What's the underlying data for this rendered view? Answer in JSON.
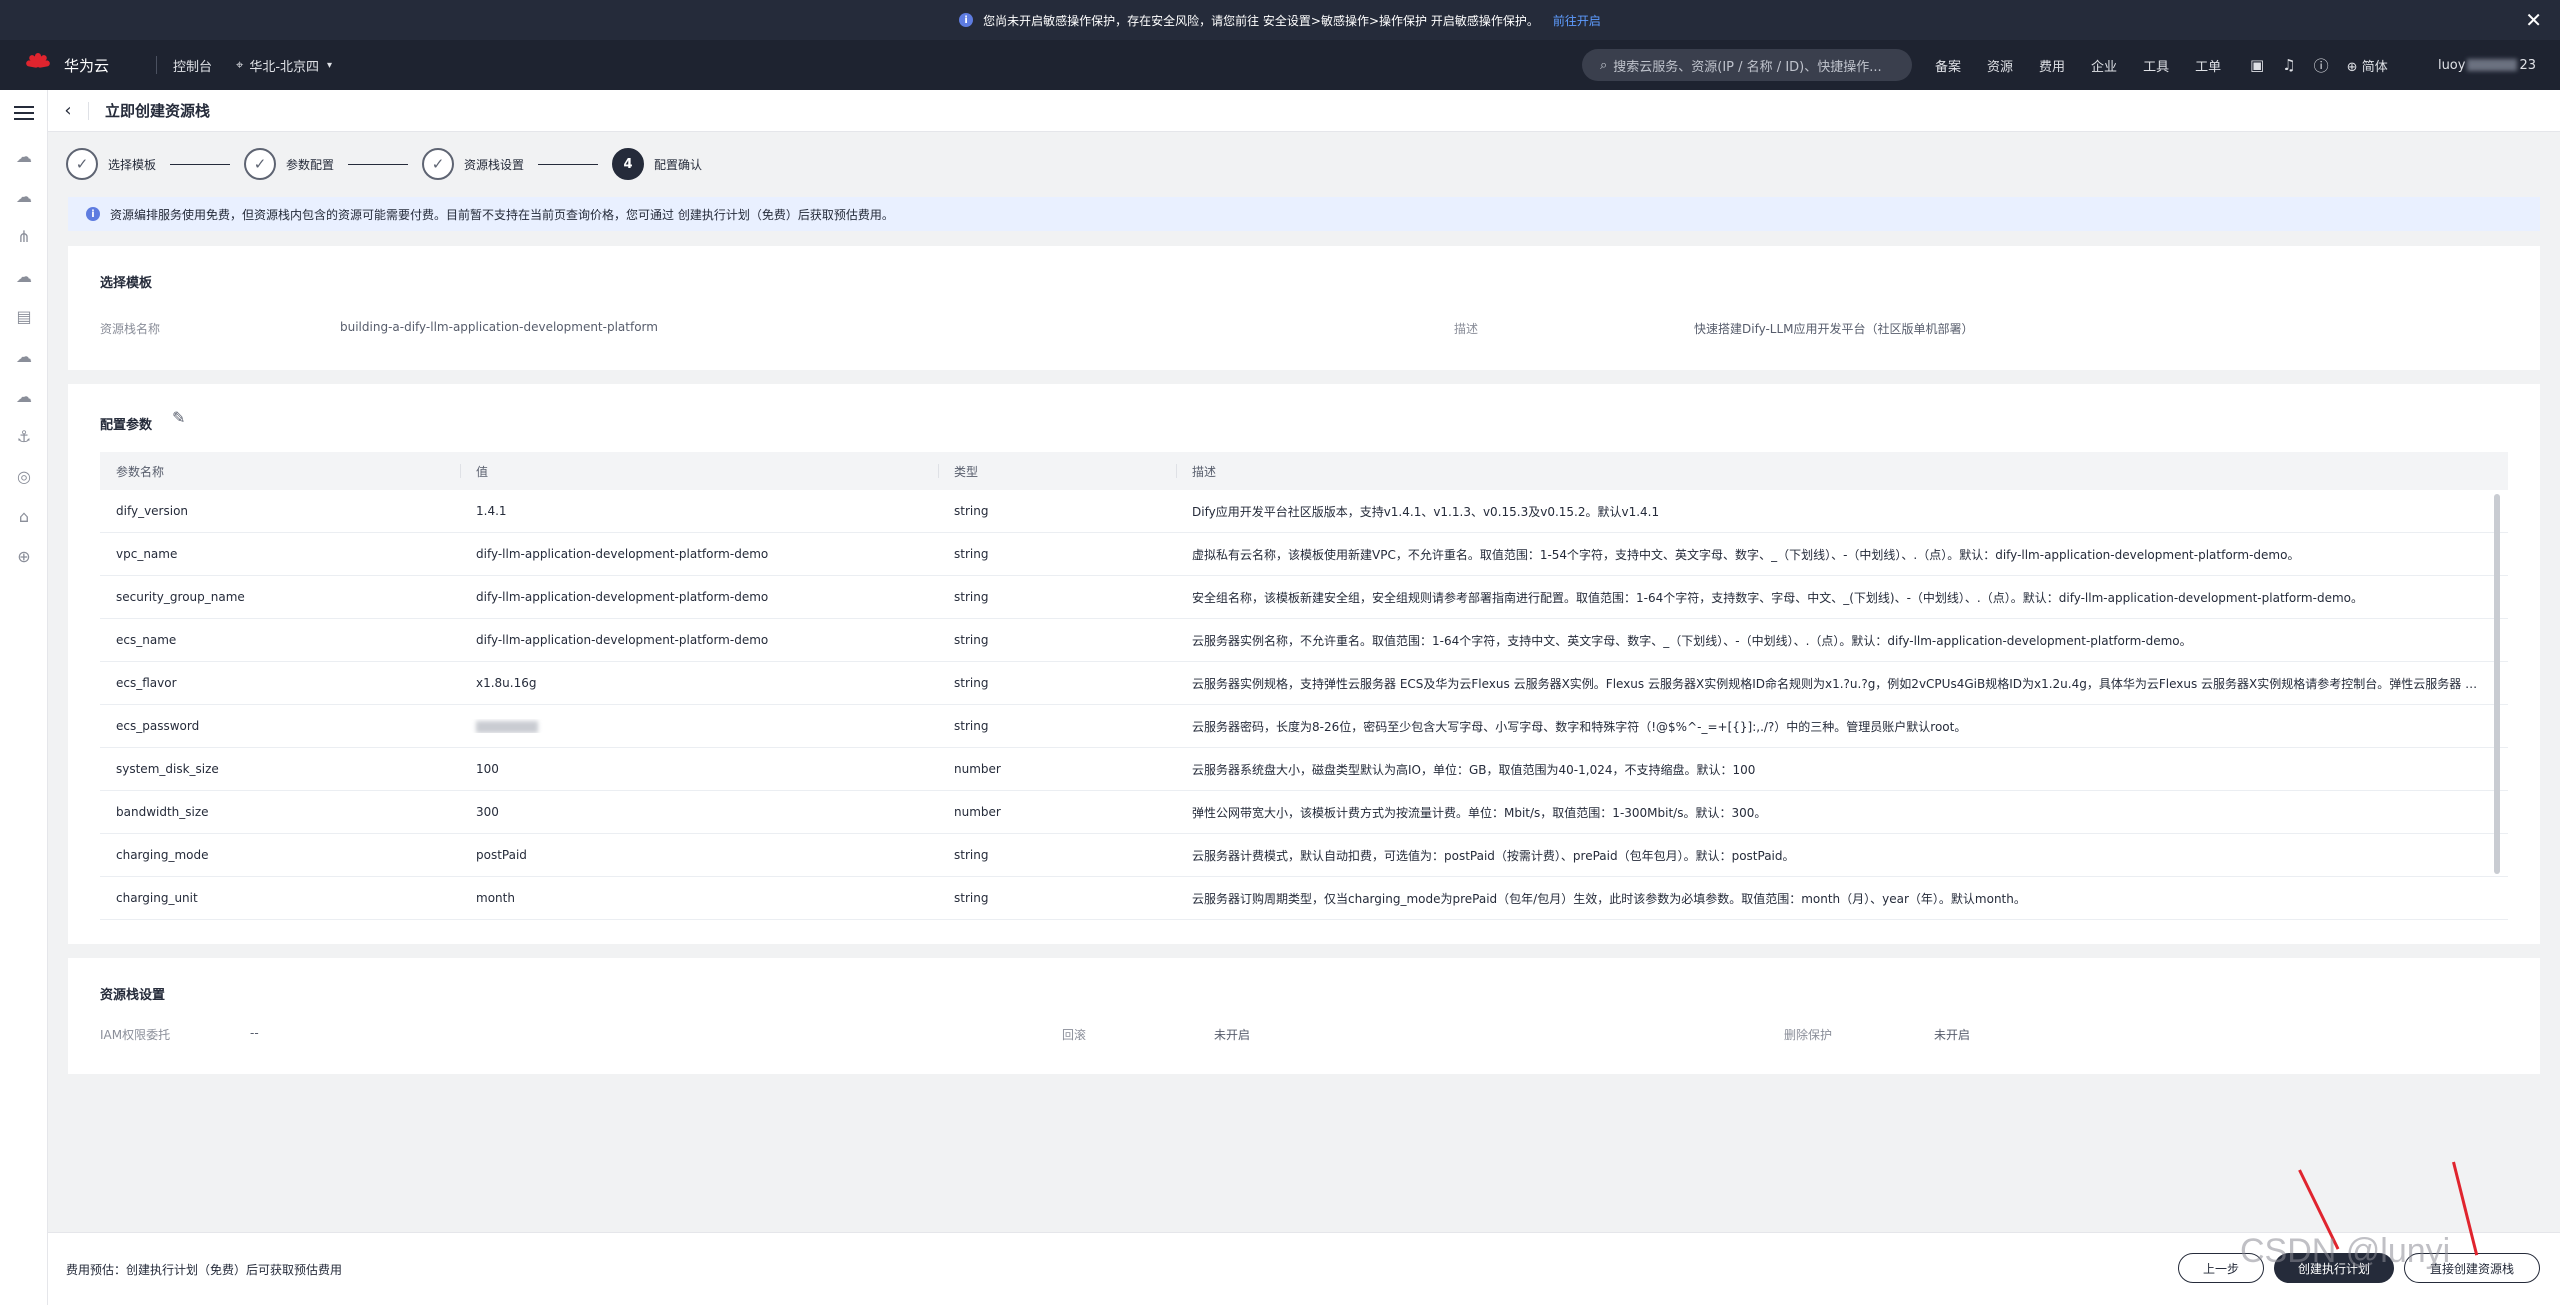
{
  "notice": {
    "text": "您尚未开启敏感操作保护，存在安全风险，请您前往 安全设置>敏感操作>操作保护 开启敏感操作保护。",
    "link": "前往开启"
  },
  "topbar": {
    "brand": "华为云",
    "console": "控制台",
    "region": "华北-北京四",
    "search_placeholder": "搜索云服务、资源(IP / 名称 / ID)、快捷操作...",
    "nav": [
      "备案",
      "资源",
      "费用",
      "企业",
      "工具",
      "工单"
    ],
    "lang": "简体",
    "user_prefix": "luoy",
    "user_suffix": "23"
  },
  "page": {
    "title": "立即创建资源栈"
  },
  "steps": [
    {
      "label": "选择模板",
      "state": "done"
    },
    {
      "label": "参数配置",
      "state": "done"
    },
    {
      "label": "资源栈设置",
      "state": "done"
    },
    {
      "label": "配置确认",
      "state": "active",
      "number": "4"
    }
  ],
  "info": "资源编排服务使用免费，但资源栈内包含的资源可能需要付费。目前暂不支持在当前页查询价格，您可通过 创建执行计划（免费）后获取预估费用。",
  "template_card": {
    "title": "选择模板",
    "name_label": "资源栈名称",
    "name_value": "building-a-dify-llm-application-development-platform",
    "desc_label": "描述",
    "desc_value": "快速搭建Dify-LLM应用开发平台（社区版单机部署）"
  },
  "params_card": {
    "title": "配置参数",
    "columns": [
      "参数名称",
      "值",
      "类型",
      "描述"
    ],
    "rows": [
      {
        "name": "dify_version",
        "value": "1.4.1",
        "type": "string",
        "desc": "Dify应用开发平台社区版版本，支持v1.4.1、v1.1.3、v0.15.3及v0.15.2。默认v1.4.1"
      },
      {
        "name": "vpc_name",
        "value": "dify-llm-application-development-platform-demo",
        "type": "string",
        "desc": "虚拟私有云名称，该模板使用新建VPC，不允许重名。取值范围：1-54个字符，支持中文、英文字母、数字、_（下划线）、-（中划线）、.（点）。默认：dify-llm-application-development-platform-demo。"
      },
      {
        "name": "security_group_name",
        "value": "dify-llm-application-development-platform-demo",
        "type": "string",
        "desc": "安全组名称，该模板新建安全组，安全组规则请参考部署指南进行配置。取值范围：1-64个字符，支持数字、字母、中文、_(下划线)、-（中划线）、.（点）。默认：dify-llm-application-development-platform-demo。"
      },
      {
        "name": "ecs_name",
        "value": "dify-llm-application-development-platform-demo",
        "type": "string",
        "desc": "云服务器实例名称，不允许重名。取值范围：1-64个字符，支持中文、英文字母、数字、_（下划线）、-（中划线）、.（点）。默认：dify-llm-application-development-platform-demo。"
      },
      {
        "name": "ecs_flavor",
        "value": "x1.8u.16g",
        "type": "string",
        "desc": "云服务器实例规格，支持弹性云服务器 ECS及华为云Flexus 云服务器X实例。Flexus 云服务器X实例规格ID命名规则为x1.?u.?g，例如2vCPUs4GiB规格ID为x1.2u.4g，具体华为云Flexus 云服务器X实例规格请参考控制台。弹性云服务器 ECS..."
      },
      {
        "name": "ecs_password",
        "value": "",
        "type": "string",
        "desc": "云服务器密码，长度为8-26位，密码至少包含大写字母、小写字母、数字和特殊字符（!@$%^-_=+[{}]:,./?）中的三种。管理员账户默认root。"
      },
      {
        "name": "system_disk_size",
        "value": "100",
        "type": "number",
        "desc": "云服务器系统盘大小，磁盘类型默认为高IO，单位：GB，取值范围为40-1,024，不支持缩盘。默认：100"
      },
      {
        "name": "bandwidth_size",
        "value": "300",
        "type": "number",
        "desc": "弹性公网带宽大小，该模板计费方式为按流量计费。单位：Mbit/s，取值范围：1-300Mbit/s。默认：300。"
      },
      {
        "name": "charging_mode",
        "value": "postPaid",
        "type": "string",
        "desc": "云服务器计费模式，默认自动扣费，可选值为：postPaid（按需计费）、prePaid（包年包月）。默认：postPaid。"
      },
      {
        "name": "charging_unit",
        "value": "month",
        "type": "string",
        "desc": "云服务器订购周期类型，仅当charging_mode为prePaid（包年/包月）生效，此时该参数为必填参数。取值范围：month（月）、year（年）。默认month。"
      }
    ]
  },
  "stack_card": {
    "title": "资源栈设置",
    "iam_label": "IAM权限委托",
    "iam_value": "--",
    "rollback_label": "回滚",
    "rollback_value": "未开启",
    "delete_label": "删除保护",
    "delete_value": "未开启"
  },
  "footer": {
    "estimate": "费用预估：创建执行计划（免费）后可获取预估费用",
    "prev": "上一步",
    "plan": "创建执行计划",
    "create": "直接创建资源栈"
  },
  "watermark": "CSDN @lunyi"
}
